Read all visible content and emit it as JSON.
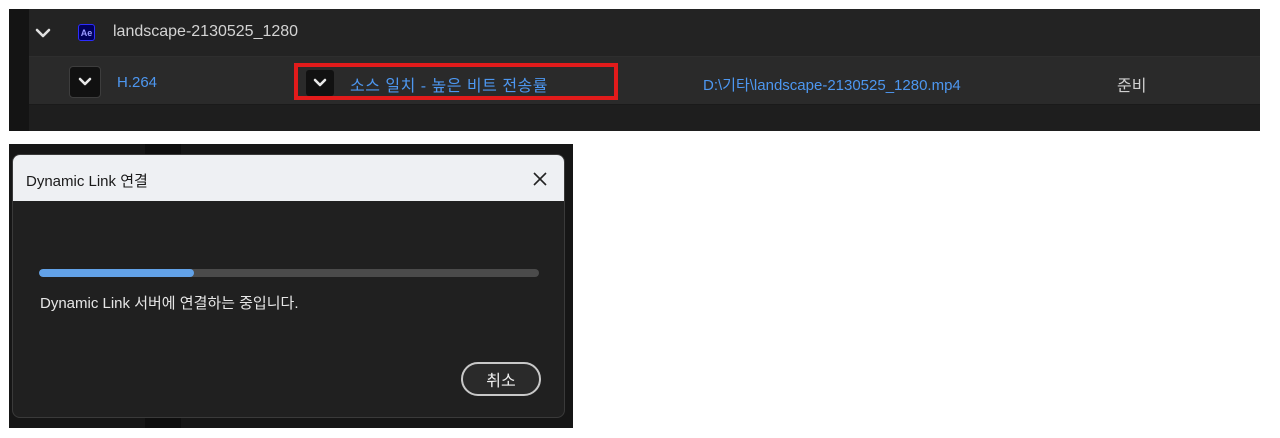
{
  "render_queue": {
    "composition": {
      "app_badge": "Ae",
      "name": "landscape-2130525_1280",
      "expand_icon": "chevron-down-icon"
    },
    "output_item": {
      "format": "H.264",
      "preset": "소스 일치 - 높은 비트 전송률",
      "output_path": "D:\\기타\\landscape-2130525_1280.mp4",
      "status": "준비",
      "highlight_color": "#e21b1b"
    }
  },
  "dialog": {
    "title": "Dynamic Link 연결",
    "close_icon": "close-icon",
    "progress_fraction": 0.31,
    "message": "Dynamic Link 서버에 연결하는 중입니다.",
    "cancel_label": "취소"
  },
  "colors": {
    "link_blue": "#4d97f0",
    "progress_blue": "#62a2e8",
    "panel_bg": "#1e1e1e"
  }
}
